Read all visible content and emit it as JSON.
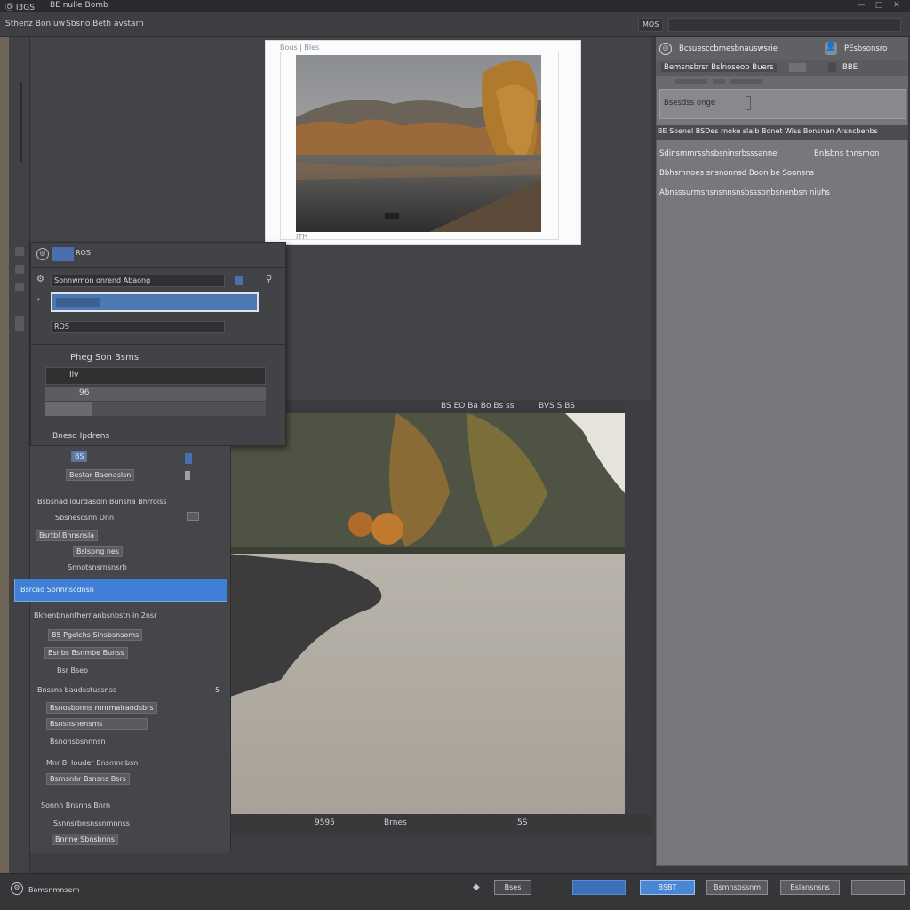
{
  "titlebar": {
    "app": "Ⓞ I3GS",
    "title": "BE nulle Bomb",
    "controls": [
      "—",
      "□",
      "✕"
    ]
  },
  "menubar": {
    "left_label": "Sthenz Bon uw",
    "left_label2": "Sbsno Beth avstarn",
    "mini_box": "MOS",
    "right_box": ""
  },
  "photo_frame": {
    "top_label": "Bous | Bles",
    "bottom_label": "ITH"
  },
  "dialog": {
    "header": "ROS",
    "field1_label": "Sonnwmon onrend Abaong",
    "field2_value": "",
    "field3_label": "ROS",
    "section_title": "Pheg Son Bsms",
    "item1": "Ilv",
    "item2": "96",
    "footer": "Bnesd Ipdrens"
  },
  "lpanel": {
    "chip_small": "BS",
    "chip_wide": "Bestar Baenaslsn",
    "group1_title": "Bsbsnad lourdasdin Bunsha Bhrrolss",
    "rows1": [
      "Sbsnescsnn Dnn",
      "Bsrtbl Bhnsnsla",
      "Bslspng nes",
      "Snnotsnsrnsnsrb"
    ],
    "highlight": "Bsrcad Sonhnscdnsn",
    "group2_title": "Bkhenbnanthernanbsnbstn in 2nsr",
    "rows2": [
      "B5 Pgelchs Sinsbsnsoms",
      "Bsnbs Bsnmbe Bunss",
      "Bsr Bseo"
    ],
    "group3_title": "Bnssns baudsstussnss",
    "rows3": [
      "Bsnosbonns mnrmalrandsbrs",
      "Bsnsnsnensms",
      "Bsnonsbsnnnsn"
    ],
    "group4_title": "Mnr Bl Iouder Bnsmnnbsn",
    "rows4": [
      "Bsrnsnhr Bsnsns Bsrs"
    ],
    "group5_title": "Sonnn Bnsnns Bnrn",
    "rows5": [
      "Ssnnsrbnsnssnmnnss",
      "Bnnne Sbnsbnns"
    ]
  },
  "ruler": {
    "label": "BS EO Ba Bo Bs ss",
    "right": "BVS S BS"
  },
  "bottombar": {
    "a": "9595",
    "b": "Brnes",
    "c": "5S"
  },
  "rpanel": {
    "header": "Bcsuesccbmesbnauswsrie",
    "header_btn": "PEsbsonsro",
    "sub1": "Bemsnsbrsr Bslnoseob Buers",
    "sub2": "BBE",
    "box_label": "Bsesdss onge",
    "section": "BE Soenel BSDes rnoke slalb Bonet Wiss Bonsnen Arsncbenbs",
    "line1_left": "Sdinsmmrsshsbsninsrbsssanne",
    "line1_right": "Bnlsbns tnnsmon",
    "line2": "Bbhsrnnoes snsnonnsd Boon be Soonsns",
    "line3": "Abnsssurmsnsnsnnsnsbsssonbsnenbsn niuhs"
  },
  "statusbar": {
    "left": "Bomsnmnsern",
    "btn_small": "Bses",
    "btn1": "",
    "btn2": "BSBT",
    "btn3": "Bsmnsbssnm",
    "btn4": "Bslansnsns",
    "btn5": ""
  },
  "colors": {
    "accent": "#3f7fd6",
    "panel": "#45464a",
    "right_panel": "#77787b"
  }
}
